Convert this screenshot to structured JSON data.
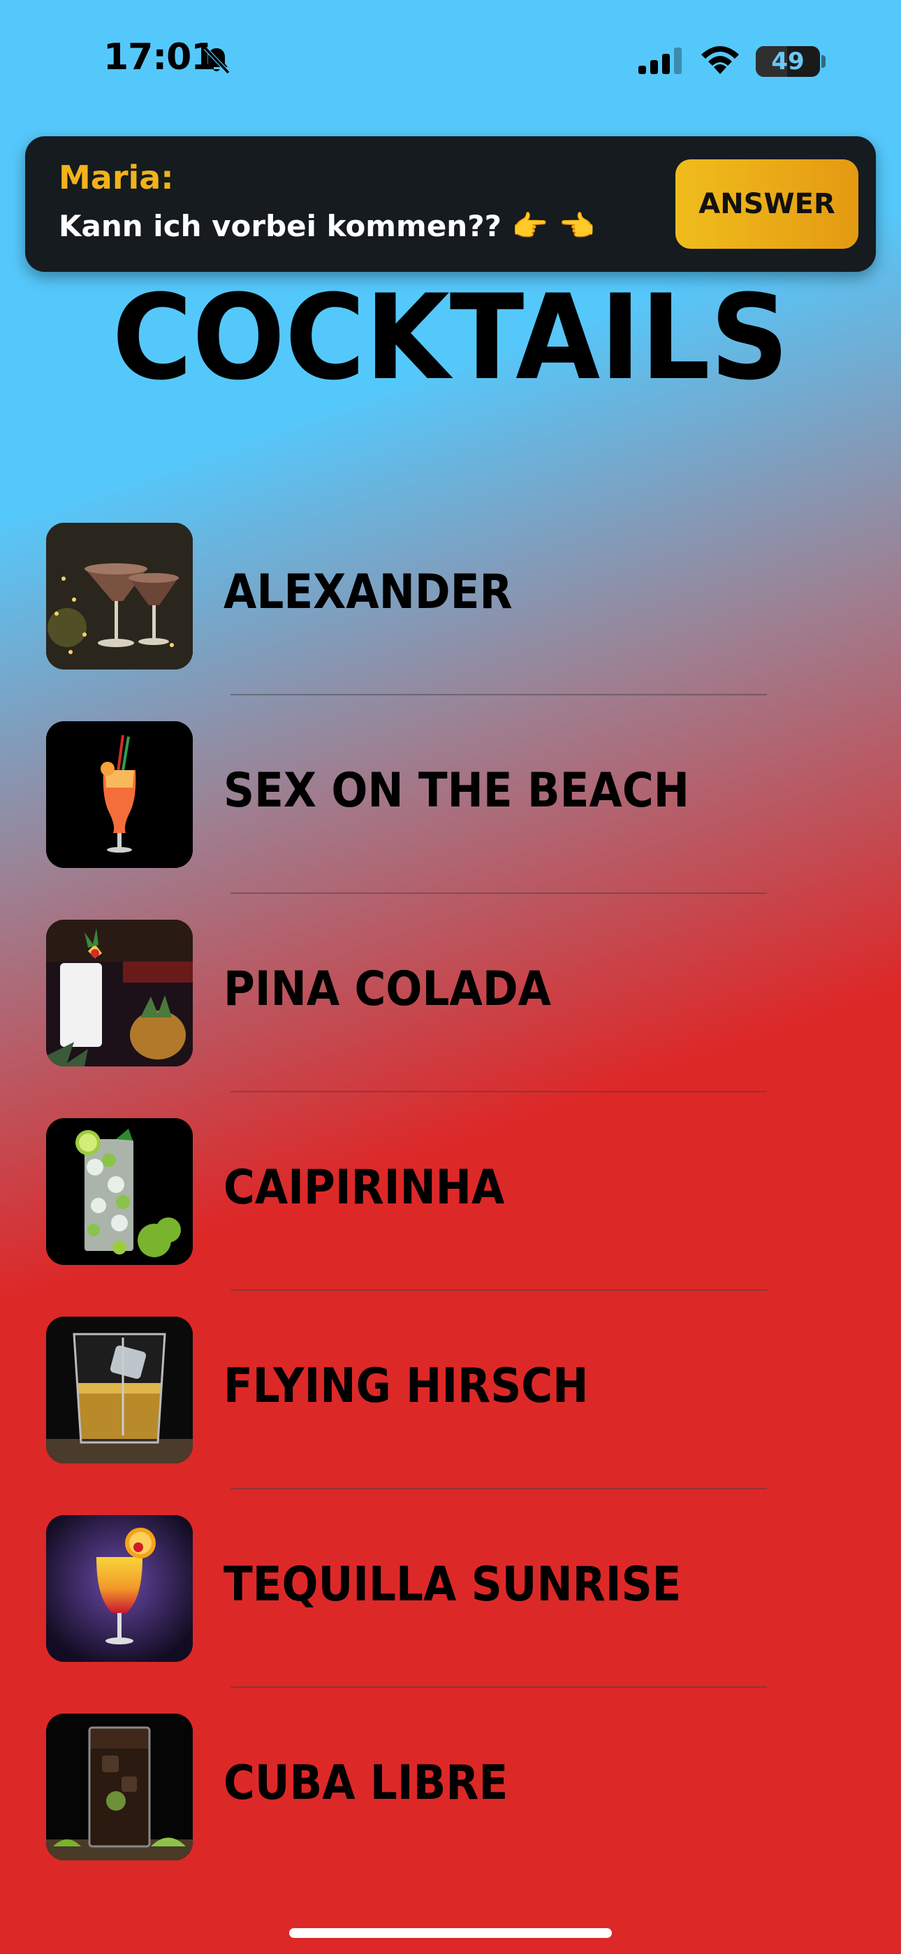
{
  "status_bar": {
    "time": "17:01",
    "battery_percent": "49",
    "battery_level": 0.49,
    "silent_mode": true
  },
  "notification": {
    "sender": "Maria:",
    "message": "Kann ich vorbei kommen?? 👉 👈",
    "action_label": "ANSWER"
  },
  "page": {
    "title": "COCKTAILS"
  },
  "cocktails": [
    {
      "name": "ALEXANDER",
      "image": "creamy-martini-glasses"
    },
    {
      "name": "SEX ON THE BEACH",
      "image": "orange-hurricane-glass-with-straws"
    },
    {
      "name": "PINA COLADA",
      "image": "white-drink-with-pineapple"
    },
    {
      "name": "CAIPIRINHA",
      "image": "highball-with-limes"
    },
    {
      "name": "FLYING HIRSCH",
      "image": "whiskey-tumbler-with-ice"
    },
    {
      "name": "TEQUILLA SUNRISE",
      "image": "layered-orange-red-cocktail"
    },
    {
      "name": "CUBA LIBRE",
      "image": "cola-highball-with-lime"
    }
  ],
  "colors": {
    "background_top": "#55c8fb",
    "background_bottom": "#dd2828",
    "banner_bg": "#151b1f",
    "sender_color": "#f2b21c",
    "button_gradient_start": "#f0bd1d",
    "button_gradient_end": "#e49a12"
  }
}
